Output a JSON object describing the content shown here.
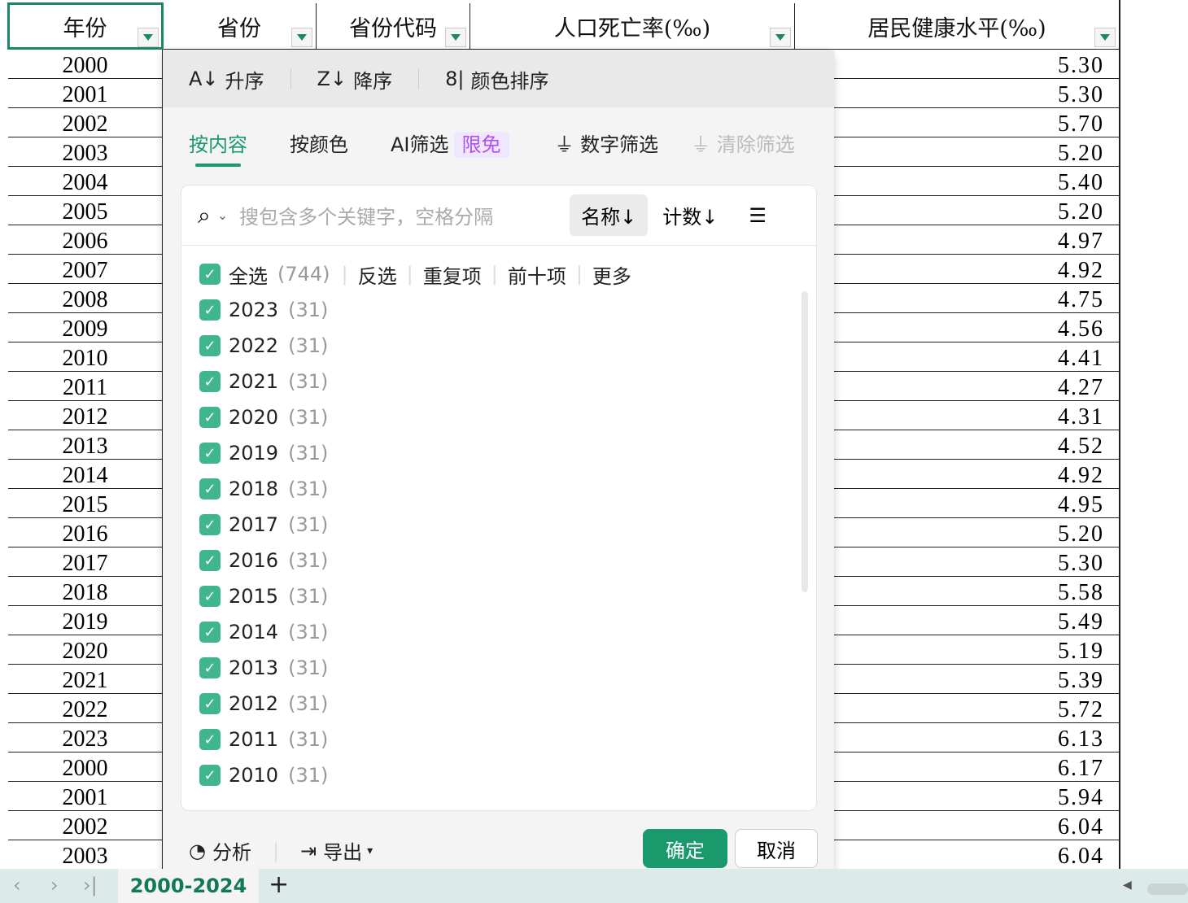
{
  "columns": [
    "年份",
    "省份",
    "省份代码",
    "人口死亡率(‰)",
    "居民健康水平(‰)"
  ],
  "rows": [
    [
      "2000",
      "5.30"
    ],
    [
      "2001",
      "5.30"
    ],
    [
      "2002",
      "5.70"
    ],
    [
      "2003",
      "5.20"
    ],
    [
      "2004",
      "5.40"
    ],
    [
      "2005",
      "5.20"
    ],
    [
      "2006",
      "4.97"
    ],
    [
      "2007",
      "4.92"
    ],
    [
      "2008",
      "4.75"
    ],
    [
      "2009",
      "4.56"
    ],
    [
      "2010",
      "4.41"
    ],
    [
      "2011",
      "4.27"
    ],
    [
      "2012",
      "4.31"
    ],
    [
      "2013",
      "4.52"
    ],
    [
      "2014",
      "4.92"
    ],
    [
      "2015",
      "4.95"
    ],
    [
      "2016",
      "5.20"
    ],
    [
      "2017",
      "5.30"
    ],
    [
      "2018",
      "5.58"
    ],
    [
      "2019",
      "5.49"
    ],
    [
      "2020",
      "5.19"
    ],
    [
      "2021",
      "5.39"
    ],
    [
      "2022",
      "5.72"
    ],
    [
      "2023",
      "6.13"
    ],
    [
      "2000",
      "6.17"
    ],
    [
      "2001",
      "5.94"
    ],
    [
      "2002",
      "6.04"
    ],
    [
      "2003",
      "6.04"
    ]
  ],
  "filter": {
    "sort": [
      "升序",
      "降序",
      "颜色排序"
    ],
    "tabs": {
      "content": "按内容",
      "color": "按颜色",
      "ai": "AI筛选",
      "ai_badge": "限免",
      "number": "数字筛选",
      "clear": "清除筛选"
    },
    "search_placeholder": "搜包含多个关键字，空格分隔",
    "sort_name": "名称↓",
    "sort_count": "计数↓",
    "select_all": "全选",
    "select_all_count": "(744)",
    "links": [
      "反选",
      "重复项",
      "前十项",
      "更多"
    ],
    "items": [
      [
        "2023",
        "(31)"
      ],
      [
        "2022",
        "(31)"
      ],
      [
        "2021",
        "(31)"
      ],
      [
        "2020",
        "(31)"
      ],
      [
        "2019",
        "(31)"
      ],
      [
        "2018",
        "(31)"
      ],
      [
        "2017",
        "(31)"
      ],
      [
        "2016",
        "(31)"
      ],
      [
        "2015",
        "(31)"
      ],
      [
        "2014",
        "(31)"
      ],
      [
        "2013",
        "(31)"
      ],
      [
        "2012",
        "(31)"
      ],
      [
        "2011",
        "(31)"
      ],
      [
        "2010",
        "(31)"
      ]
    ],
    "analyze": "分析",
    "export": "导出",
    "ok": "确定",
    "cancel": "取消",
    "accent": "#1a9a6c"
  },
  "sheet_tab": "2000-2024"
}
